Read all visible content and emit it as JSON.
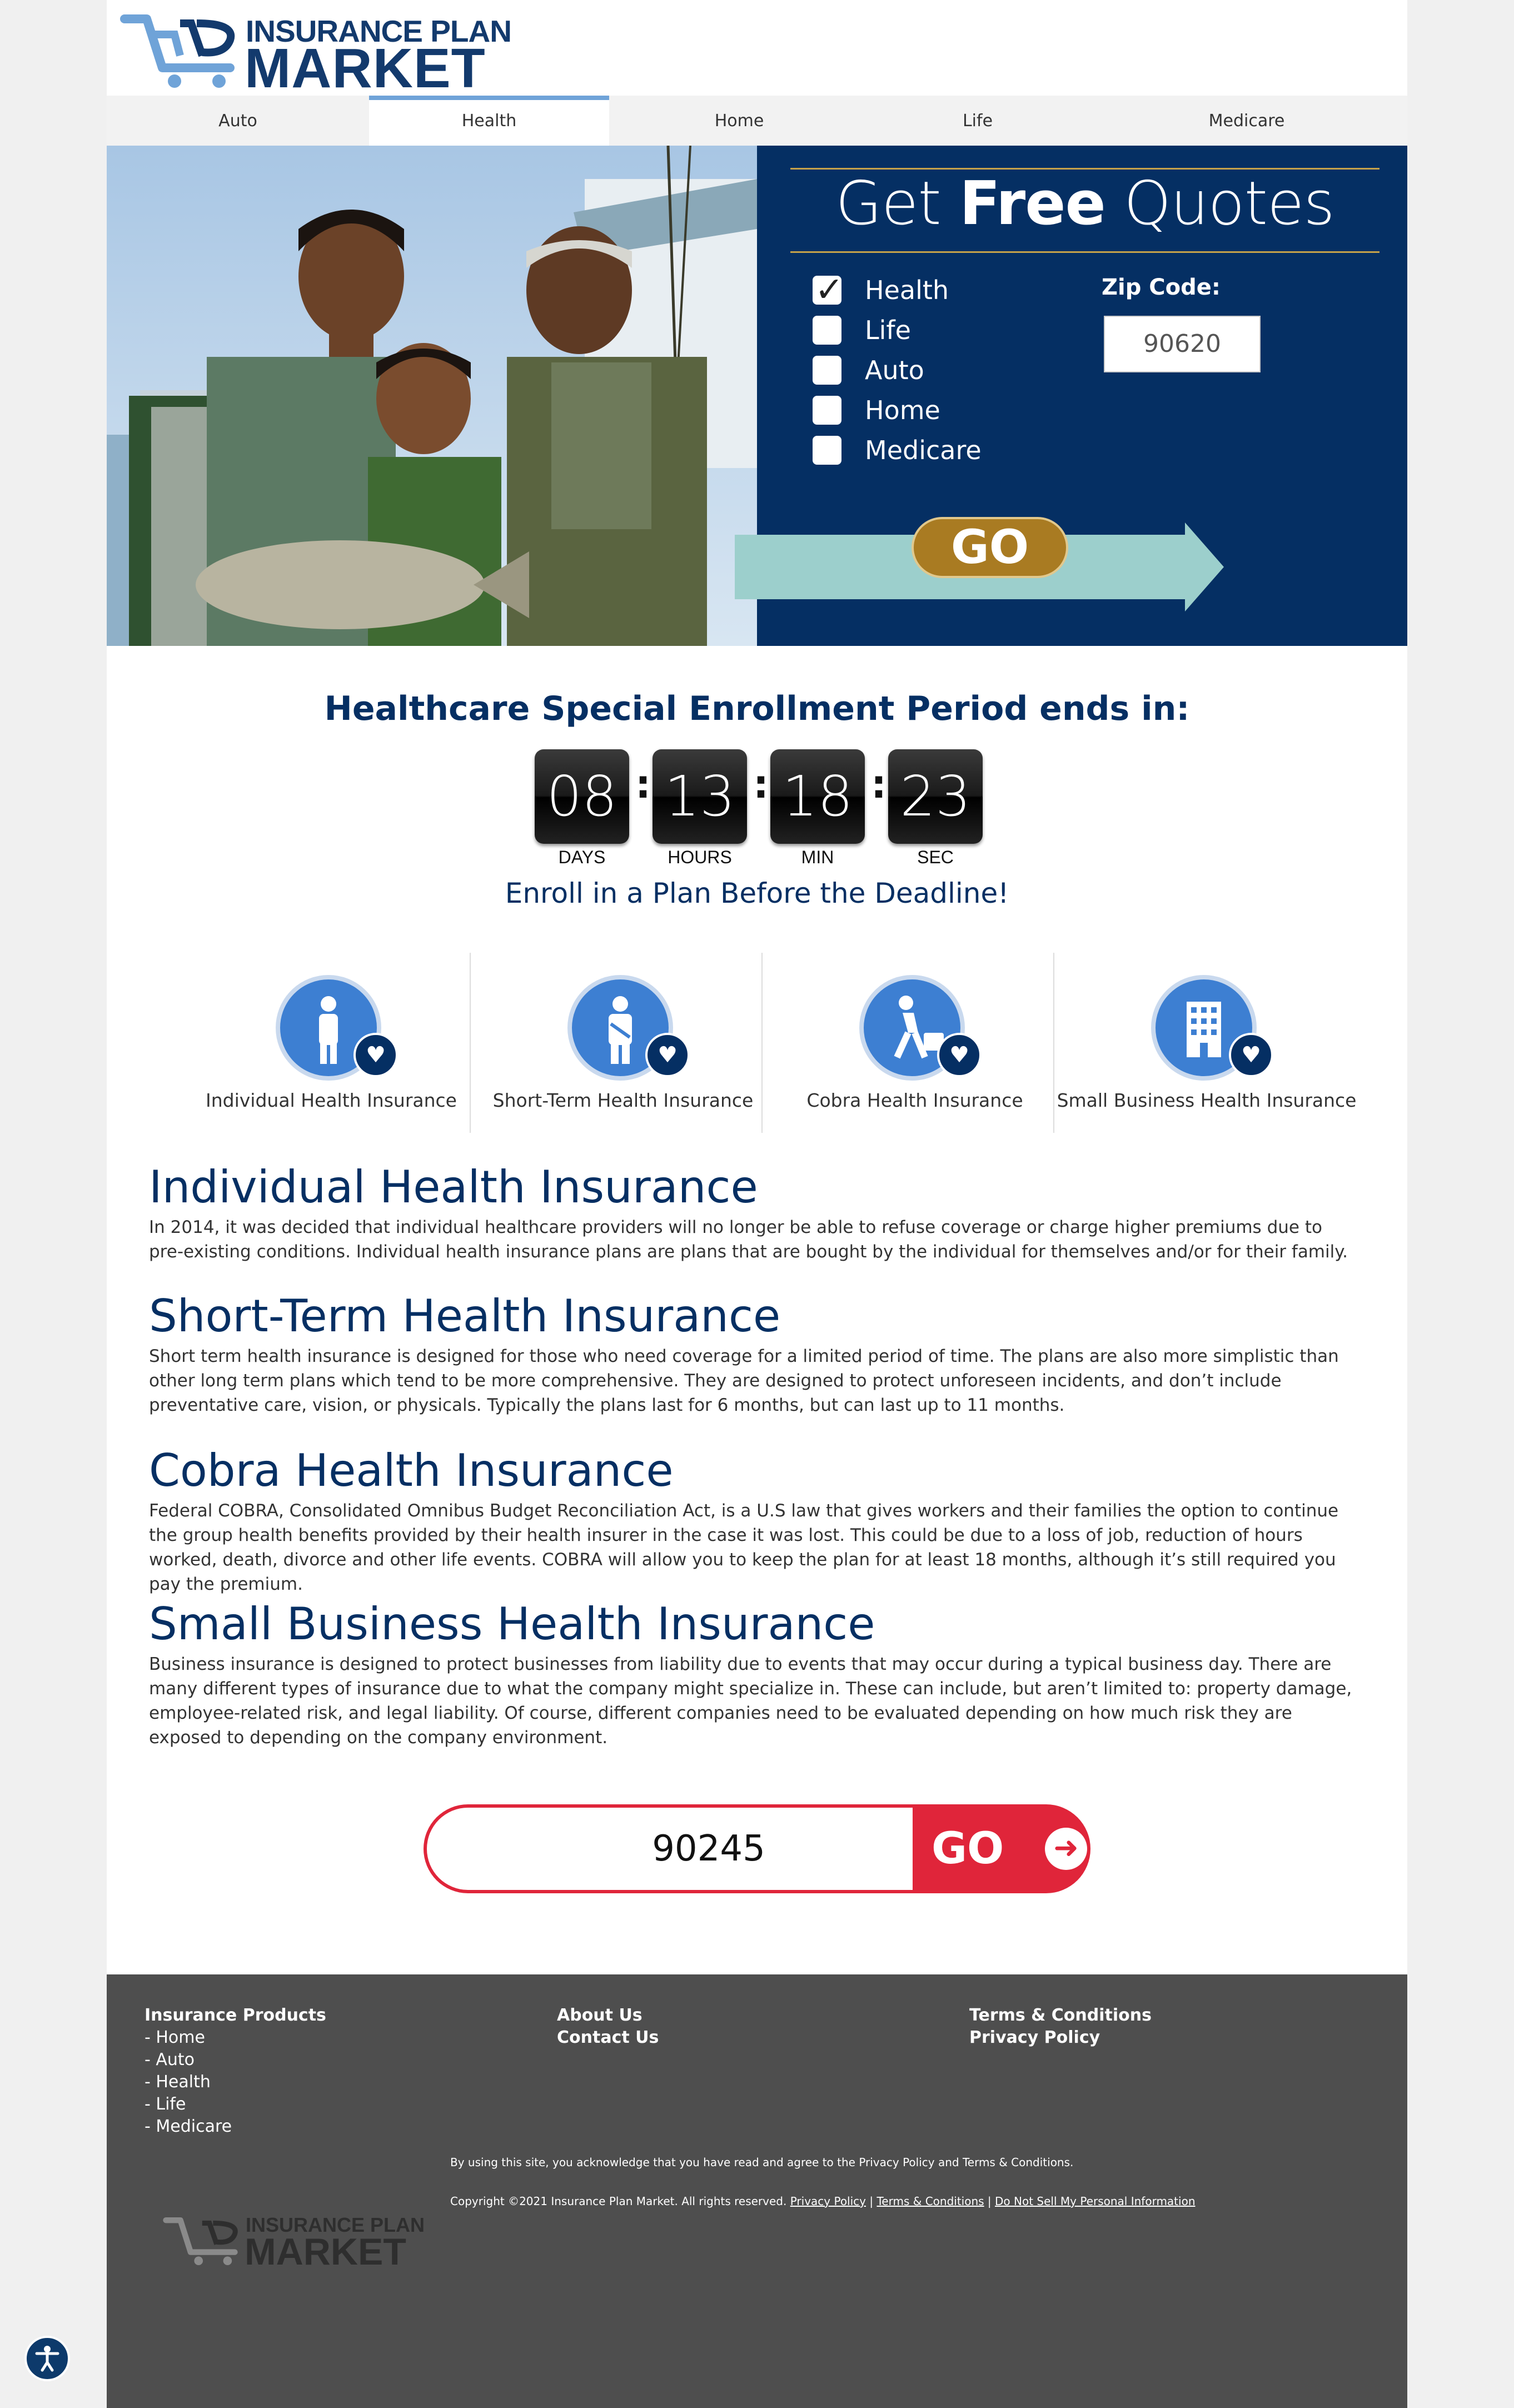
{
  "header": {
    "logo_line1": "INSURANCE PLAN",
    "logo_line2": "MARKET"
  },
  "nav": {
    "tabs": [
      {
        "label": "Auto",
        "active": false
      },
      {
        "label": "Health",
        "active": true
      },
      {
        "label": "Home",
        "active": false
      },
      {
        "label": "Life",
        "active": false
      },
      {
        "label": "Medicare",
        "active": false
      }
    ]
  },
  "quote_panel": {
    "title_pre": "Get",
    "title_bold": "Free",
    "title_post": "Quotes",
    "options": [
      {
        "label": "Health",
        "checked": true
      },
      {
        "label": "Life",
        "checked": false
      },
      {
        "label": "Auto",
        "checked": false
      },
      {
        "label": "Home",
        "checked": false
      },
      {
        "label": "Medicare",
        "checked": false
      }
    ],
    "zip_label": "Zip Code:",
    "zip_value": "90620",
    "go_label": "GO",
    "colors": {
      "panel": "#052f63",
      "gold": "#c6a24a",
      "arrow": "#9ccfcc",
      "button": "#a97b22"
    }
  },
  "countdown": {
    "title": "Healthcare Special Enrollment Period ends in:",
    "days": "08",
    "hours": "13",
    "min": "18",
    "sec": "23",
    "labels": {
      "days": "DAYS",
      "hours": "HOURS",
      "min": "MIN",
      "sec": "SEC"
    },
    "subtitle": "Enroll in a Plan Before the Deadline!"
  },
  "products": [
    {
      "label": "Individual Health Insurance",
      "icon": "person-icon"
    },
    {
      "label": "Short-Term Health Insurance",
      "icon": "injured-person-icon"
    },
    {
      "label": "Cobra Health Insurance",
      "icon": "worker-icon"
    },
    {
      "label": "Small Business Health Insurance",
      "icon": "building-icon"
    }
  ],
  "sections": [
    {
      "title": "Individual Health Insurance",
      "body": "In 2014, it was decided that individual healthcare providers will no longer be able to refuse coverage or charge higher premiums due to pre-existing conditions. Individual health insurance plans are plans that are bought by the individual for themselves and/or for their family."
    },
    {
      "title": "Short-Term Health Insurance",
      "body": "Short term health insurance is designed for those who need coverage for a limited period of time. The plans are also more simplistic than other long term plans which tend to be more comprehensive. They are designed to protect unforeseen incidents, and don’t include preventative care, vision, or physicals. Typically the plans last for 6 months, but can last up to 11 months."
    },
    {
      "title": "Cobra Health Insurance",
      "body": "Federal COBRA, Consolidated Omnibus Budget Reconciliation Act, is a U.S law that gives workers and their families the option to continue the group health benefits provided by their health insurer in the case it was lost. This could be due to a loss of job, reduction of hours worked, death, divorce and other life events. COBRA will allow you to keep the plan for at least 18 months, although it’s still required you pay the premium."
    },
    {
      "title": "Small Business Health Insurance",
      "body": "Business insurance is designed to protect businesses from liability due to events that may occur during a typical business day. There are many different types of insurance due to what the company might specialize in. These can include, but aren’t limited to: property damage, employee-related risk, and legal liability. Of course, different companies need to be evaluated depending on how much risk they are exposed to depending on the company environment."
    }
  ],
  "bottom_form": {
    "zip_value": "90245",
    "go_label": "GO",
    "color": "#e0253a"
  },
  "footer": {
    "products_head": "Insurance Products",
    "products_links": [
      "- Home",
      "- Auto",
      "- Health",
      "- Life",
      "- Medicare"
    ],
    "about": "About Us",
    "contact": "Contact Us",
    "terms": "Terms & Conditions",
    "privacy": "Privacy Policy",
    "note": "By using this site, you acknowledge that you have read and agree to the Privacy Policy and Terms & Conditions.",
    "copyright": "Copyright ©2021 Insurance Plan Market. All rights reserved.",
    "link_privacy": "Privacy Policy",
    "link_terms": "Terms & Conditions",
    "link_dns": "Do Not Sell My Personal Information",
    "sep": "|",
    "logo_line1": "INSURANCE PLAN",
    "logo_line2": "MARKET"
  }
}
